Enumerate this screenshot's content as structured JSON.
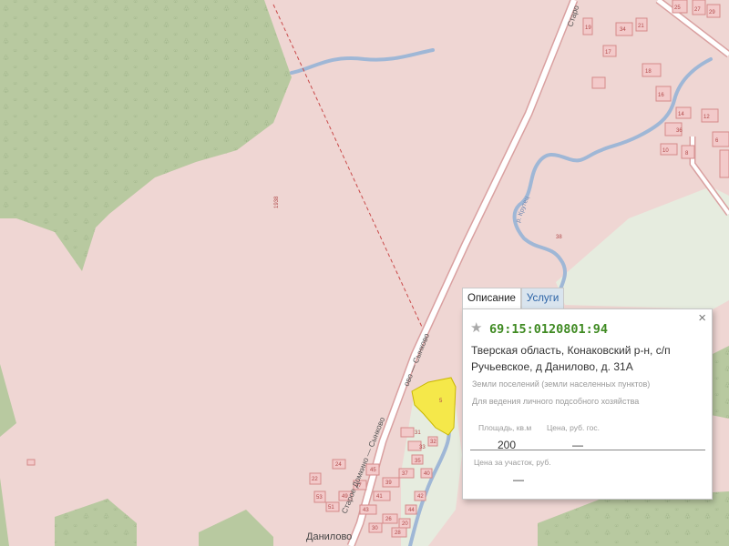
{
  "map": {
    "labels": {
      "area_code": "1938",
      "road_upper": "Старо",
      "road_mid": "ово — Сынково",
      "road_lower": "Старое Домкино — Сынково",
      "river": "р. Крутец",
      "village": "Данилово",
      "parcel_5": "5",
      "lot_34": "34",
      "lot_36": "36",
      "lot_38": "38",
      "lot_31": "31",
      "lot_33": "33",
      "lot_35": "35",
      "lot_37": "37",
      "lot_39": "39",
      "lot_41": "41",
      "lot_43": "43",
      "lot_45": "45",
      "lot_47": "47",
      "lot_49": "49",
      "lot_51": "51",
      "lot_53": "53",
      "lot_22": "22",
      "lot_24": "24",
      "lot_26": "26",
      "lot_28": "28",
      "lot_30": "30",
      "lot_32": "32",
      "lot_40": "40",
      "lot_42": "42",
      "lot_44": "44",
      "lot_20": "20",
      "lot_19": "19",
      "lot_17": "17",
      "lot_21": "21",
      "lot_25": "25",
      "lot_27": "27",
      "lot_29": "29",
      "lot_18": "18",
      "lot_16": "16",
      "lot_14": "14",
      "lot_12": "12",
      "lot_10": "10",
      "lot_8": "8",
      "lot_6": "6"
    },
    "colors": {
      "land": "#efd6d3",
      "forest": "#b8c9a0",
      "field": "#e6ecdf",
      "road": "#ffffff",
      "river": "#9fb7d6",
      "parcel_outline": "#d48a8a",
      "selected_parcel": "#f5e84a"
    },
    "icons": {
      "forest_symbol": "tree-icon"
    }
  },
  "popup": {
    "tabs": {
      "description": "Описание",
      "services": "Услуги"
    },
    "active_tab": "Описание",
    "close_icon": "×",
    "star_icon": "★",
    "cadastral_number": "69:15:0120801:94",
    "address": "Тверская область, Конаковский р-н, с/п Ручьевское, д Данилово, д. 31А",
    "category": "Земли поселений (земли населенных пунктов)",
    "permitted_use": "Для ведения личного подсобного хозяйства",
    "area_label": "Площадь, кв.м",
    "area_value": "200",
    "price_label": "Цена, руб. гос.",
    "price_value": "—",
    "plot_price_label": "Цена за участок, руб.",
    "plot_price_value": "—"
  }
}
